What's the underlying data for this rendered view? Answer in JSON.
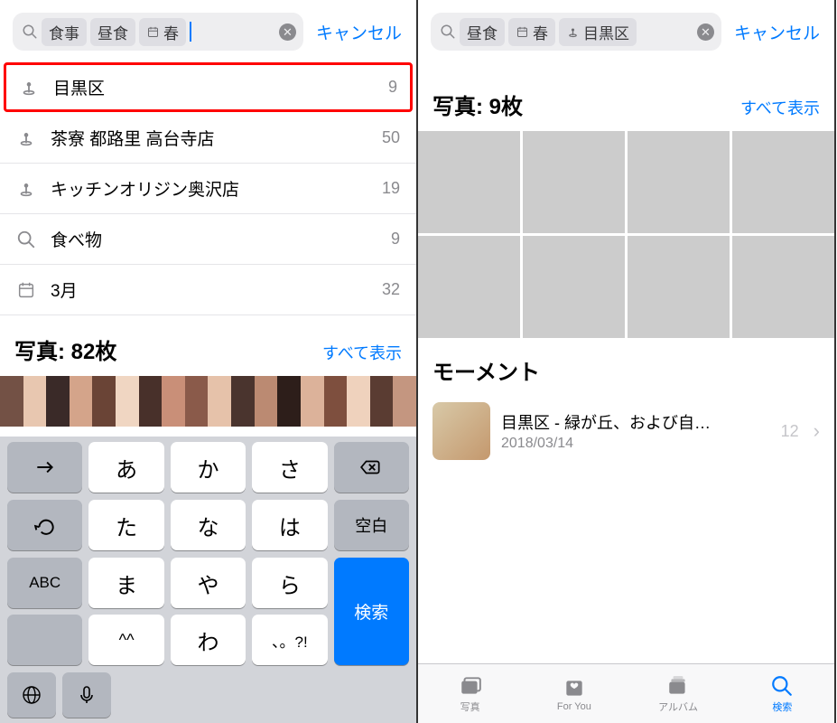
{
  "left": {
    "search": {
      "tokens": [
        {
          "label": "食事",
          "icon": null
        },
        {
          "label": "昼食",
          "icon": null
        },
        {
          "label": "春",
          "icon": "calendar"
        }
      ],
      "cancel": "キャンセル"
    },
    "suggestions": [
      {
        "icon": "pin",
        "label": "目黒区",
        "count": 9,
        "highlight": true
      },
      {
        "icon": "pin",
        "label": "茶寮 都路里 高台寺店",
        "count": 50
      },
      {
        "icon": "pin",
        "label": "キッチンオリジン奥沢店",
        "count": 19
      },
      {
        "icon": "search",
        "label": "食べ物",
        "count": 9
      },
      {
        "icon": "calendar",
        "label": "3月",
        "count": 32
      }
    ],
    "photos": {
      "title": "写真: 82枚",
      "show_all": "すべて表示"
    },
    "keyboard": {
      "rows": [
        [
          "arrow",
          "あ",
          "か",
          "さ",
          "backspace"
        ],
        [
          "undo",
          "た",
          "な",
          "は",
          "空白"
        ],
        [
          "ABC",
          "ま",
          "や",
          "ら"
        ],
        [
          "",
          "^^",
          "わ",
          "、。?!"
        ]
      ],
      "search_key": "検索",
      "util": [
        "globe",
        "mic"
      ]
    }
  },
  "right": {
    "search": {
      "tokens": [
        {
          "label": "昼食",
          "icon": null
        },
        {
          "label": "春",
          "icon": "calendar"
        },
        {
          "label": "目黒区",
          "icon": "pin"
        }
      ],
      "cancel": "キャンセル"
    },
    "photos": {
      "title": "写真: 9枚",
      "show_all": "すべて表示"
    },
    "moments": {
      "heading": "モーメント",
      "items": [
        {
          "title": "目黒区 - 緑が丘、および自…",
          "date": "2018/03/14",
          "count": 12
        }
      ]
    },
    "tabs": [
      {
        "label": "写真",
        "icon": "photos"
      },
      {
        "label": "For You",
        "icon": "foryou"
      },
      {
        "label": "アルバム",
        "icon": "albums"
      },
      {
        "label": "検索",
        "icon": "search",
        "active": true
      }
    ]
  }
}
